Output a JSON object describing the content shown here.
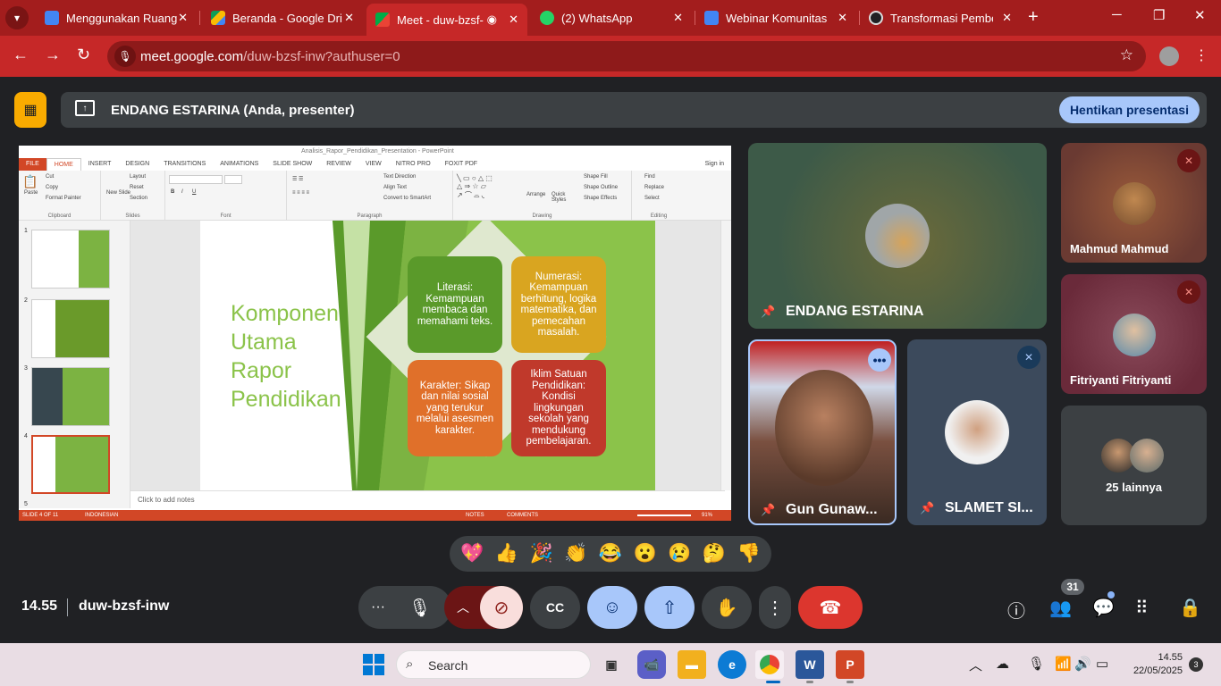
{
  "browser": {
    "tabs": [
      {
        "title": "Menggunakan Ruang",
        "favicon_color": "#4285f4"
      },
      {
        "title": "Beranda - Google Dri",
        "favicon_color": "#fbbc04"
      },
      {
        "title": "Meet - duw-bzsf-",
        "favicon_color": "#00ac47",
        "active": true
      },
      {
        "title": "(2) WhatsApp",
        "favicon_color": "#25d366"
      },
      {
        "title": "Webinar Komunitas",
        "favicon_color": "#4285f4"
      },
      {
        "title": "Transformasi Pembel",
        "favicon_color": "#202124"
      }
    ],
    "url_host": "meet.google.com",
    "url_path": "/duw-bzsf-inw?authuser=0"
  },
  "presenter_bar": {
    "name": "ENDANG ESTARINA (Anda, presenter)",
    "stop_label": "Hentikan presentasi"
  },
  "powerpoint": {
    "window_title": "Analisis_Rapor_Pendidikan_Presentation - PowerPoint",
    "tabs": [
      "FILE",
      "HOME",
      "INSERT",
      "DESIGN",
      "TRANSITIONS",
      "ANIMATIONS",
      "SLIDE SHOW",
      "REVIEW",
      "VIEW",
      "NITRO PRO",
      "FOXIT PDF"
    ],
    "sign_in": "Sign in",
    "groups": {
      "clipboard": "Clipboard",
      "slides": "Slides",
      "font": "Font",
      "paragraph": "Paragraph",
      "drawing": "Drawing",
      "editing": "Editing"
    },
    "ribbon_items": {
      "paste": "Paste",
      "cut": "Cut",
      "copy": "Copy",
      "format_painter": "Format Painter",
      "new_slide": "New Slide",
      "layout": "Layout",
      "reset": "Reset",
      "section": "Section",
      "text_direction": "Text Direction",
      "align_text": "Align Text",
      "convert_smartart": "Convert to SmartArt",
      "arrange": "Arrange",
      "quick_styles": "Quick Styles",
      "shape_fill": "Shape Fill",
      "shape_outline": "Shape Outline",
      "shape_effects": "Shape Effects",
      "find": "Find",
      "replace": "Replace",
      "select": "Select"
    },
    "thumbnails": [
      "1",
      "2",
      "3",
      "4",
      "5"
    ],
    "slide": {
      "title": "Komponen Utama Rapor Pendidikan",
      "cards": [
        {
          "text": "Literasi: Kemampuan membaca dan memahami teks.",
          "color": "#5a9a2a"
        },
        {
          "text": "Numerasi: Kemampuan berhitung, logika matematika, dan pemecahan masalah.",
          "color": "#d9a520"
        },
        {
          "text": "Karakter: Sikap dan nilai sosial yang terukur melalui asesmen karakter.",
          "color": "#e0702a"
        },
        {
          "text": "Iklim Satuan Pendidikan: Kondisi lingkungan sekolah yang mendukung pembelajaran.",
          "color": "#c0392b"
        }
      ]
    },
    "notes_placeholder": "Click to add notes",
    "status": {
      "slide_of": "SLIDE 4 OF 11",
      "language": "INDONESIAN",
      "notes": "NOTES",
      "comments": "COMMENTS",
      "zoom": "91%"
    }
  },
  "participants": [
    {
      "name": "ENDANG ESTARINA",
      "tile_bg": "#4a5a45"
    },
    {
      "name": "Mahmud Mahmud",
      "tile_bg": "#7a4a3a"
    },
    {
      "name": "Fitriyanti Fitriyanti",
      "tile_bg": "#8a3a4a"
    },
    {
      "name": "Gun Gunaw...",
      "tile_bg": "#a03030"
    },
    {
      "name": "SLAMET SI...",
      "tile_bg": "#3c4a5c"
    }
  ],
  "others": {
    "label": "25 lainnya"
  },
  "reactions": [
    "💖",
    "👍",
    "🎉",
    "👏",
    "😂",
    "😮",
    "😢",
    "🤔",
    "👎"
  ],
  "meeting": {
    "time": "14.55",
    "code": "duw-bzsf-inw",
    "people_count": "31"
  },
  "taskbar": {
    "search_placeholder": "Search",
    "time": "14.55",
    "date": "22/05/2025",
    "notifications": "3"
  }
}
